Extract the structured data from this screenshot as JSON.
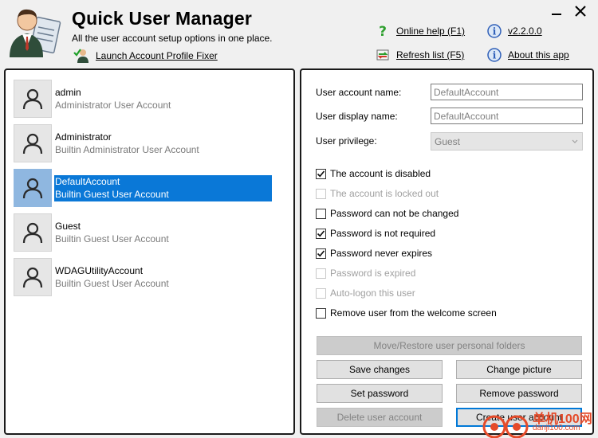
{
  "header": {
    "title": "Quick User Manager",
    "subtitle": "All the user account setup options in one place.",
    "launch_link": "Launch Account Profile Fixer",
    "online_help": "Online help (F1)",
    "version": "v2.2.0.0",
    "refresh": "Refresh list (F5)",
    "about": "About this app"
  },
  "users": [
    {
      "name": "admin",
      "desc": "Administrator User Account",
      "selected": false
    },
    {
      "name": "Administrator",
      "desc": "Builtin Administrator User Account",
      "selected": false
    },
    {
      "name": "DefaultAccount",
      "desc": "Builtin Guest User Account",
      "selected": true
    },
    {
      "name": "Guest",
      "desc": "Builtin Guest User Account",
      "selected": false
    },
    {
      "name": "WDAGUtilityAccount",
      "desc": "Builtin Guest User Account",
      "selected": false
    }
  ],
  "form": {
    "account_name_label": "User account name:",
    "account_name_value": "DefaultAccount",
    "display_name_label": "User display name:",
    "display_name_value": "DefaultAccount",
    "privilege_label": "User privilege:",
    "privilege_value": "Guest"
  },
  "checkboxes": [
    {
      "label": "The account is disabled",
      "checked": true,
      "enabled": true
    },
    {
      "label": "The account is locked out",
      "checked": false,
      "enabled": false
    },
    {
      "label": "Password can not be changed",
      "checked": false,
      "enabled": true
    },
    {
      "label": "Password is not required",
      "checked": true,
      "enabled": true
    },
    {
      "label": "Password never expires",
      "checked": true,
      "enabled": true
    },
    {
      "label": "Password is expired",
      "checked": false,
      "enabled": false
    },
    {
      "label": "Auto-logon this user",
      "checked": false,
      "enabled": false
    },
    {
      "label": "Remove user from the welcome screen",
      "checked": false,
      "enabled": true
    }
  ],
  "buttons": {
    "move_restore": "Move/Restore user personal folders",
    "save": "Save changes",
    "change_picture": "Change picture",
    "set_password": "Set password",
    "remove_password": "Remove password",
    "delete_user": "Delete user account",
    "create_user": "Create user account"
  },
  "watermark": {
    "text": "单机100网",
    "sub": "danji100.com"
  },
  "colors": {
    "selection": "#0a78d7",
    "selection_avatar": "#8fb7e0",
    "help_icon": "#2e9f2e",
    "info_icon": "#2f5fb8",
    "watermark": "#e54b2a"
  }
}
